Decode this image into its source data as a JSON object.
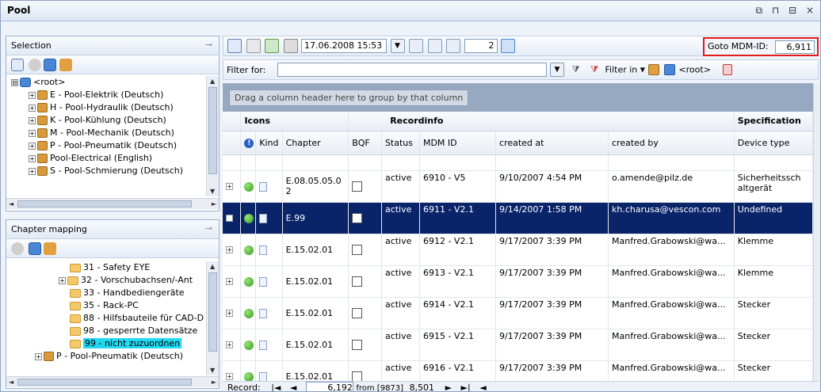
{
  "window": {
    "title": "Pool",
    "controls": "⧉ ⊓ ⊟ ×"
  },
  "selection": {
    "title": "Selection",
    "items": [
      {
        "label": "<root>",
        "level": 0,
        "sign": "⊟"
      },
      {
        "label": "E - Pool-Elektrik (Deutsch)",
        "level": 1,
        "sign": "+"
      },
      {
        "label": "H - Pool-Hydraulik (Deutsch)",
        "level": 1,
        "sign": "+"
      },
      {
        "label": "K - Pool-Kühlung (Deutsch)",
        "level": 1,
        "sign": "+"
      },
      {
        "label": "M - Pool-Mechanik (Deutsch)",
        "level": 1,
        "sign": "+"
      },
      {
        "label": "P - Pool-Pneumatik (Deutsch)",
        "level": 1,
        "sign": "+"
      },
      {
        "label": "Pool-Electrical (English)",
        "level": 1,
        "sign": "+"
      },
      {
        "label": "S - Pool-Schmierung (Deutsch)",
        "level": 1,
        "sign": "+"
      }
    ]
  },
  "chapter_mapping": {
    "title": "Chapter mapping",
    "items": [
      {
        "label": "31 - Safety EYE",
        "sign": ""
      },
      {
        "label": "32 - Vorschubachsen/-Ant",
        "sign": "+"
      },
      {
        "label": "33 - Handbediengeräte",
        "sign": ""
      },
      {
        "label": "35 - Rack-PC",
        "sign": ""
      },
      {
        "label": "88 - Hilfsbauteile für CAD-D",
        "sign": ""
      },
      {
        "label": "98 - gesperrte Datensätze",
        "sign": ""
      },
      {
        "label": "99 - nicht zuzuordnen",
        "sign": "",
        "selected": true
      },
      {
        "label": "P - Pool-Pneumatik (Deutsch)",
        "sign": "+",
        "cube": true
      }
    ]
  },
  "toolbar": {
    "datetime": "17.06.2008 15:53",
    "count": "2",
    "goto_label": "Goto MDM-ID:",
    "goto_value": "6,911"
  },
  "filter": {
    "label": "Filter for:",
    "value": "",
    "filter_in": "Filter in",
    "root": "<root>"
  },
  "grid": {
    "group_hint": "Drag a column header here to group by that column",
    "bands": [
      {
        "label": "Icons"
      },
      {
        "label": "Recordinfo"
      },
      {
        "label": "Specification"
      }
    ],
    "columns": [
      "Kind",
      "Chapter",
      "BQF",
      "Status",
      "MDM ID",
      "created at",
      "created by",
      "Device type"
    ],
    "rows": [
      {
        "chapter": "E.08.05.05.0 2",
        "status": "active",
        "mdm": "6910 - V5",
        "created": "9/10/2007 4:54 PM",
        "by": "o.amende@pilz.de",
        "device": "Sicherheitssch altgerät"
      },
      {
        "chapter": "E.99",
        "status": "active",
        "mdm": "6911 - V2.1",
        "created": "9/14/2007 1:58 PM",
        "by": "kh.charusa@vescon.com",
        "device": "Undefined",
        "selected": true
      },
      {
        "chapter": "E.15.02.01",
        "status": "active",
        "mdm": "6912 - V2.1",
        "created": "9/17/2007 3:39 PM",
        "by": "Manfred.Grabowski@wa...",
        "device": "Klemme"
      },
      {
        "chapter": "E.15.02.01",
        "status": "active",
        "mdm": "6913 - V2.1",
        "created": "9/17/2007 3:39 PM",
        "by": "Manfred.Grabowski@wa...",
        "device": "Klemme"
      },
      {
        "chapter": "E.15.02.01",
        "status": "active",
        "mdm": "6914 - V2.1",
        "created": "9/17/2007 3:39 PM",
        "by": "Manfred.Grabowski@wa...",
        "device": "Stecker"
      },
      {
        "chapter": "E.15.02.01",
        "status": "active",
        "mdm": "6915 - V2.1",
        "created": "9/17/2007 3:39 PM",
        "by": "Manfred.Grabowski@wa...",
        "device": "Stecker"
      },
      {
        "chapter": "E.15.02.01",
        "status": "active",
        "mdm": "6916 - V2.1",
        "created": "9/17/2007 3:39 PM",
        "by": "Manfred.Grabowski@wa...",
        "device": "Stecker"
      }
    ]
  },
  "nav": {
    "record_label": "Record:",
    "current": "6,192",
    "from_text": "from [9873]",
    "extra": "8,501"
  }
}
